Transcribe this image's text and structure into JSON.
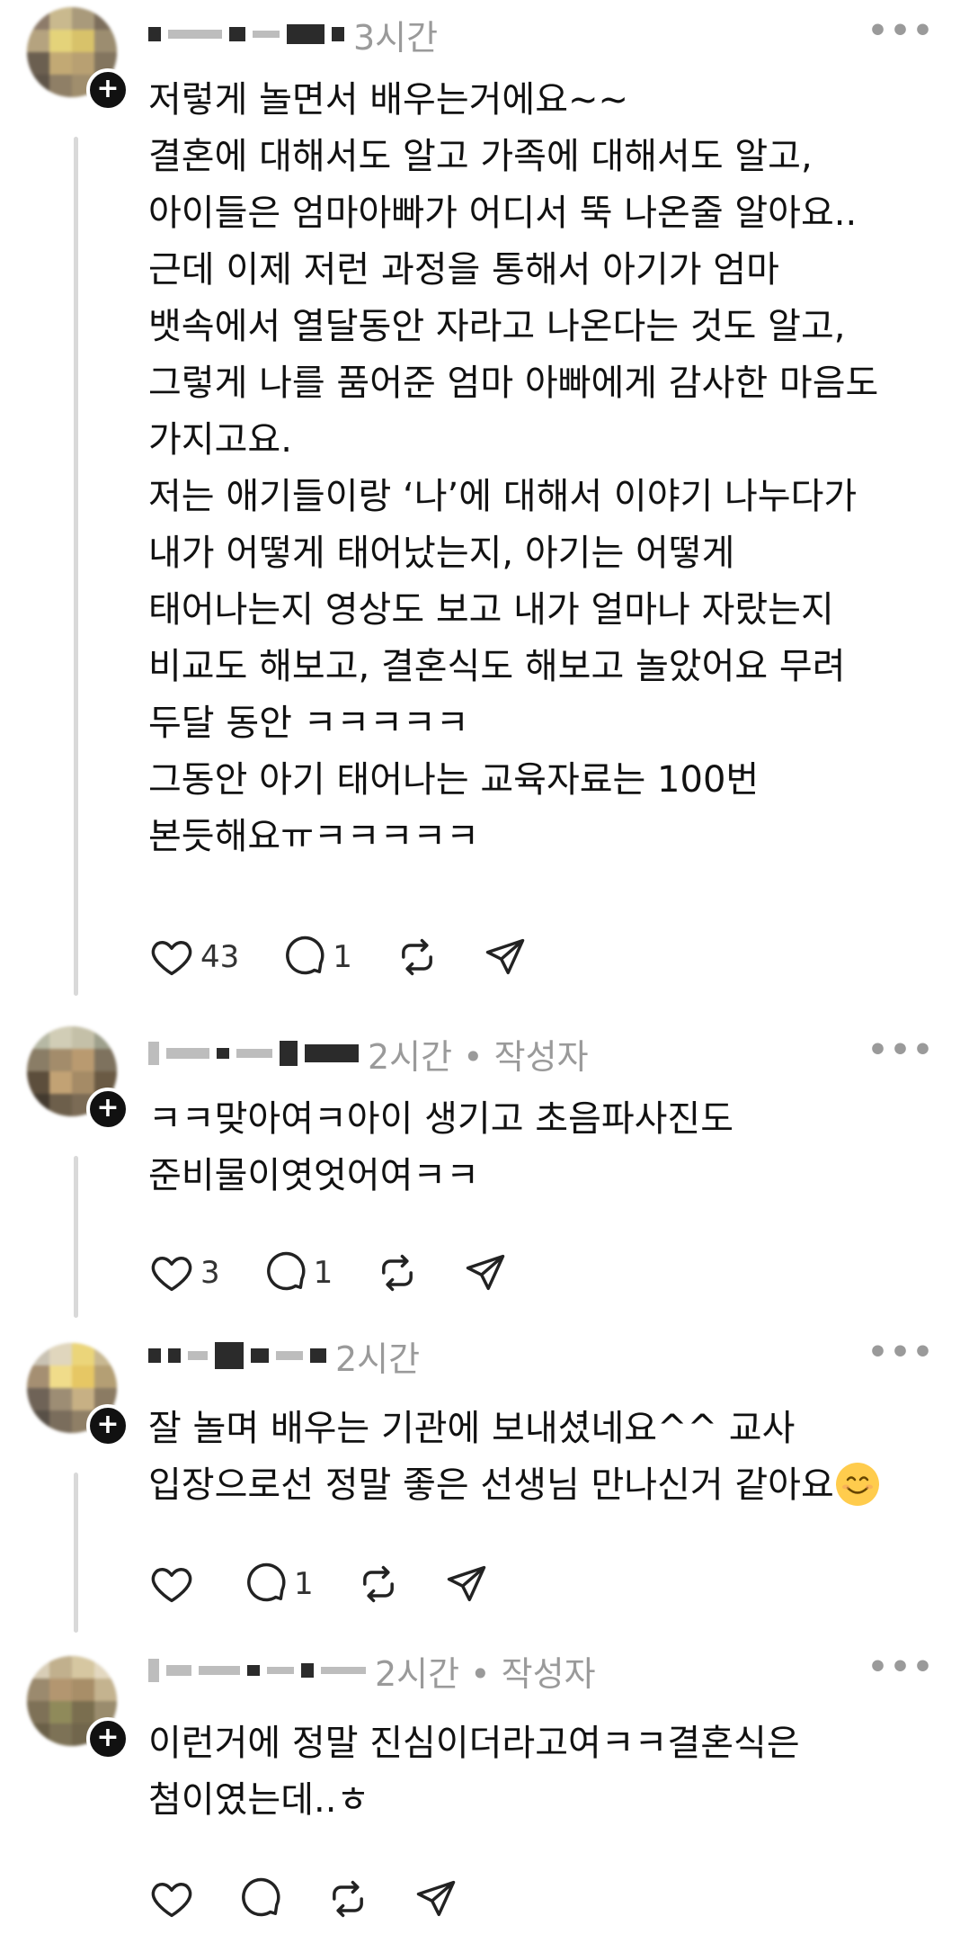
{
  "comments": [
    {
      "meta": "3시간",
      "lines": [
        "저렇게 놀면서 배우는거에요~~",
        "결혼에 대해서도 알고 가족에 대해서도 알고,",
        "아이들은 엄마아빠가 어디서 뚝 나온줄 알아요..",
        "근데 이제 저런 과정을 통해서 아기가 엄마",
        "뱃속에서 열달동안 자라고 나온다는 것도 알고,",
        "그렇게 나를 품어준 엄마 아빠에게 감사한 마음도",
        "가지고요.",
        "저는 애기들이랑 ‘나’에 대해서 이야기 나누다가",
        "내가 어떻게 태어났는지, 아기는 어떻게",
        "태어나는지 영상도 보고 내가 얼마나 자랐는지",
        "비교도 해보고, 결혼식도 해보고 놀았어요 무려",
        "두달 동안 ㅋㅋㅋㅋㅋ",
        "그동안 아기 태어나는 교육자료는 100번",
        "본듯해요ㅠㅋㅋㅋㅋㅋ"
      ],
      "likes": "43",
      "replies": "1"
    },
    {
      "meta": "2시간 • 작성자",
      "lines": [
        "ㅋㅋ맞아여ㅋ아이 생기고 초음파사진도",
        "준비물이엿엇어여ㅋㅋ"
      ],
      "likes": "3",
      "replies": "1"
    },
    {
      "meta": "2시간",
      "lines": [
        "잘 놀며 배우는 기관에 보내셨네요^^ 교사",
        "입장으로선 정말 좋은 선생님 만나신거 같아요"
      ],
      "emoji": "smiling-face-emoji",
      "likes": "",
      "replies": "1"
    },
    {
      "meta": "2시간 • 작성자",
      "lines": [
        "이런거에 정말 진심이더라고여ㅋㅋ결혼식은",
        "첨이였는데..ㅎ"
      ],
      "likes": "",
      "replies": ""
    }
  ],
  "icons": {
    "like": "heart-icon",
    "reply": "speech-bubble-icon",
    "repost": "repost-icon",
    "share": "send-icon",
    "more": "more-options-icon",
    "follow": "plus-icon"
  }
}
